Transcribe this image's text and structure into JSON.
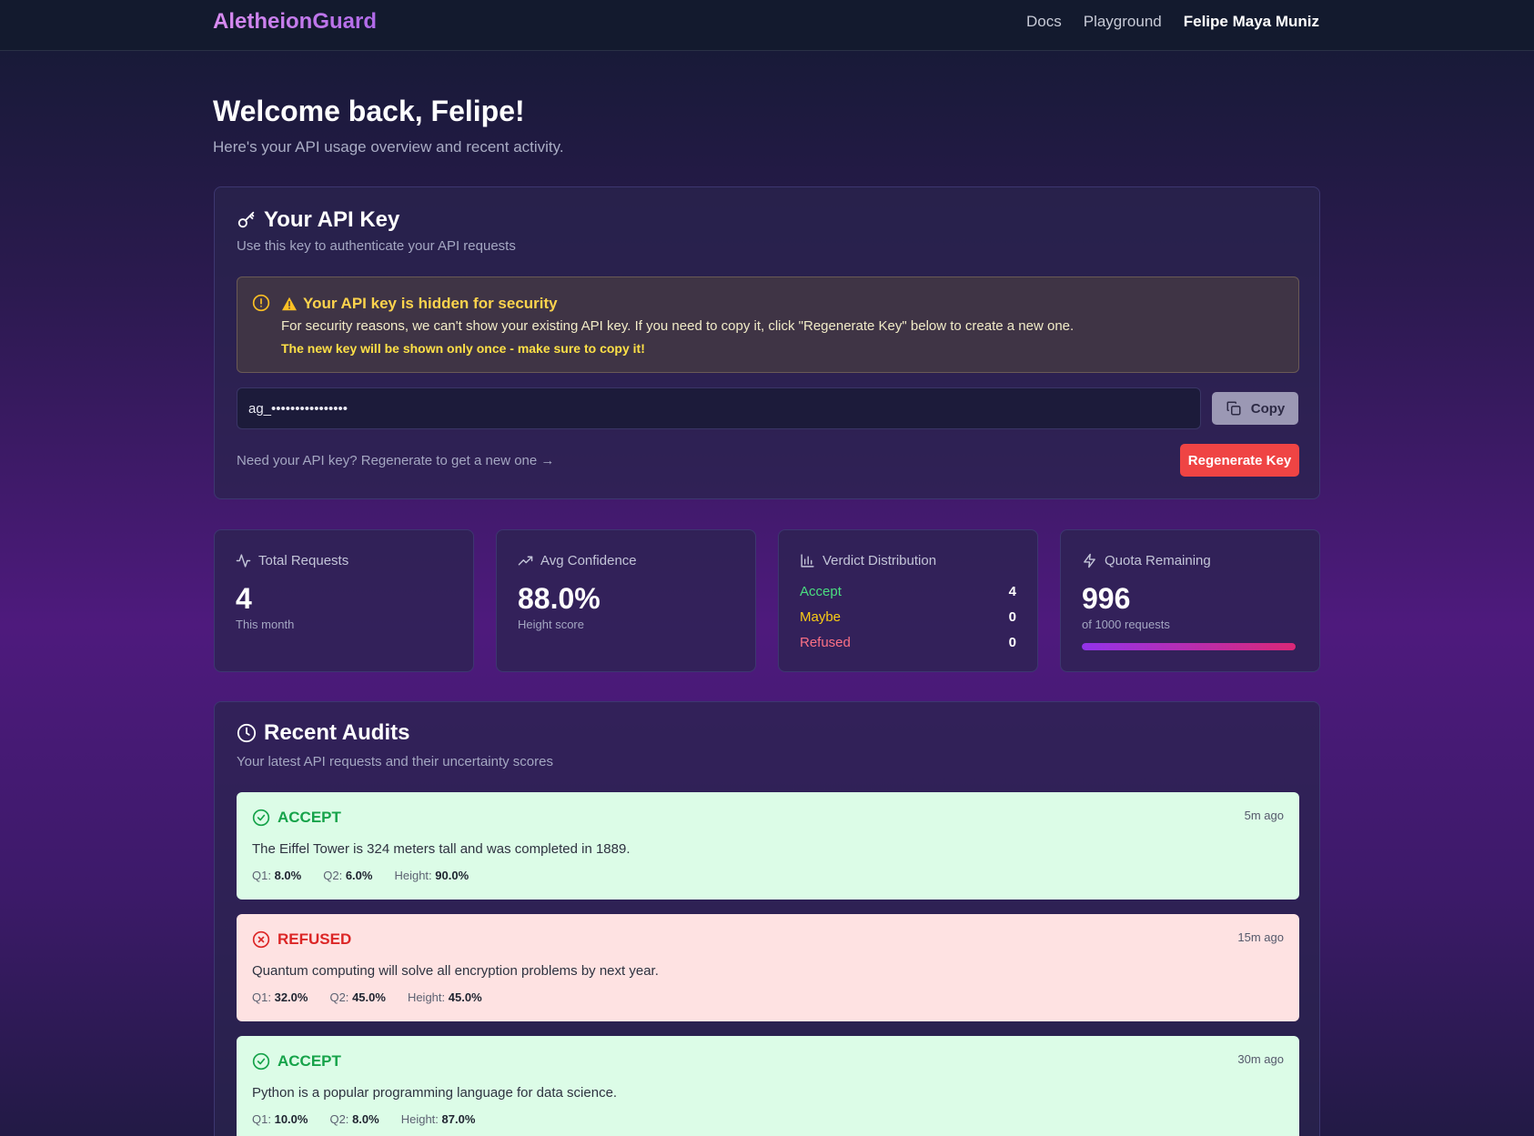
{
  "header": {
    "brand": "AletheionGuard",
    "nav": {
      "docs": "Docs",
      "playground": "Playground",
      "user": "Felipe Maya Muniz"
    }
  },
  "welcome": {
    "title": "Welcome back, Felipe!",
    "subtitle": "Here's your API usage overview and recent activity."
  },
  "api_key": {
    "title": "Your API Key",
    "subtitle": "Use this key to authenticate your API requests",
    "warning_title": "Your API key is hidden for security",
    "warning_text": "For security reasons, we can't show your existing API key. If you need to copy it, click \"Regenerate Key\" below to create a new one.",
    "warning_strong": "The new key will be shown only once - make sure to copy it!",
    "key_value": "ag_••••••••••••••••",
    "copy_label": "Copy",
    "regen_hint": "Need your API key? Regenerate to get a new one →",
    "regen_label": "Regenerate Key"
  },
  "stats": {
    "total_requests": {
      "label": "Total Requests",
      "value": "4",
      "note": "This month"
    },
    "avg_confidence": {
      "label": "Avg Confidence",
      "value": "88.0%",
      "note": "Height score"
    },
    "verdict_distribution": {
      "label": "Verdict Distribution",
      "rows": [
        {
          "name": "Accept",
          "count": "4",
          "color": "#4ade80"
        },
        {
          "name": "Maybe",
          "count": "0",
          "color": "#facc15"
        },
        {
          "name": "Refused",
          "count": "0",
          "color": "#fb7185"
        }
      ]
    },
    "quota": {
      "label": "Quota Remaining",
      "value": "996",
      "note": "of 1000 requests",
      "fraction": 0.996
    }
  },
  "audits": {
    "title": "Recent Audits",
    "subtitle": "Your latest API requests and their uncertainty scores",
    "items": [
      {
        "verdict": "ACCEPT",
        "time": "5m ago",
        "text": "The Eiffel Tower is 324 meters tall and was completed in 1889.",
        "q1_label": "Q1:",
        "q1": "8.0%",
        "q2_label": "Q2:",
        "q2": "6.0%",
        "height_label": "Height:",
        "height": "90.0%"
      },
      {
        "verdict": "REFUSED",
        "time": "15m ago",
        "text": "Quantum computing will solve all encryption problems by next year.",
        "q1_label": "Q1:",
        "q1": "32.0%",
        "q2_label": "Q2:",
        "q2": "45.0%",
        "height_label": "Height:",
        "height": "45.0%"
      },
      {
        "verdict": "ACCEPT",
        "time": "30m ago",
        "text": "Python is a popular programming language for data science.",
        "q1_label": "Q1:",
        "q1": "10.0%",
        "q2_label": "Q2:",
        "q2": "8.0%",
        "height_label": "Height:",
        "height": "87.0%"
      }
    ]
  }
}
